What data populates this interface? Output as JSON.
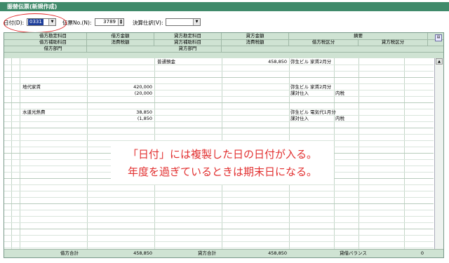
{
  "window": {
    "title": "振替伝票(新規作成)"
  },
  "toolbar": {
    "date_label": "日付(D):",
    "date_value": "0331",
    "voucher_label": "伝票No.(N):",
    "voucher_value": "3789",
    "settlement_label": "決算仕訳(V):",
    "settlement_value": ""
  },
  "header": {
    "row1": [
      "借方勘定科目",
      "借方金額",
      "貸方勘定科目",
      "貸方金額",
      "摘要"
    ],
    "row2": [
      "借方補助科目",
      "消費税額",
      "貸方補助科目",
      "消費税額",
      "借方税区分",
      "貸方税区分"
    ],
    "row3": [
      "借方部門",
      "貸方部門"
    ]
  },
  "entries": [
    {
      "debit_account": "",
      "debit_amount": "",
      "debit_tax": "",
      "credit_account": "普通預金",
      "credit_amount": "458,850",
      "memo": "弥生ビル 家賃2月分",
      "debit_tax_class": "",
      "debit_tax_type": ""
    },
    {
      "debit_account": "地代家賃",
      "debit_amount": "420,000",
      "debit_tax": "(20,000",
      "credit_account": "",
      "credit_amount": "",
      "memo": "弥生ビル 家賃2月分",
      "debit_tax_class": "課対仕入",
      "debit_tax_type": "内税"
    },
    {
      "debit_account": "水道光熱費",
      "debit_amount": "38,850",
      "debit_tax": "(1,850",
      "credit_account": "",
      "credit_amount": "",
      "memo": "弥生ビル 電気代1月分",
      "debit_tax_class": "課対仕入",
      "debit_tax_type": "内税"
    }
  ],
  "footer": {
    "debit_total_label": "借方合計",
    "debit_total": "458,850",
    "credit_total_label": "貸方合計",
    "credit_total": "458,850",
    "balance_label": "貸借バランス",
    "balance": "0"
  },
  "notice": {
    "line1": "「日付」には複製した日の日付が入る。",
    "line2": "年度を過ぎているときは期末日になる。"
  },
  "colors": {
    "titlebar": "#3f8a6a",
    "header_bg": "#cfe3d3",
    "annotation": "#e02424"
  }
}
